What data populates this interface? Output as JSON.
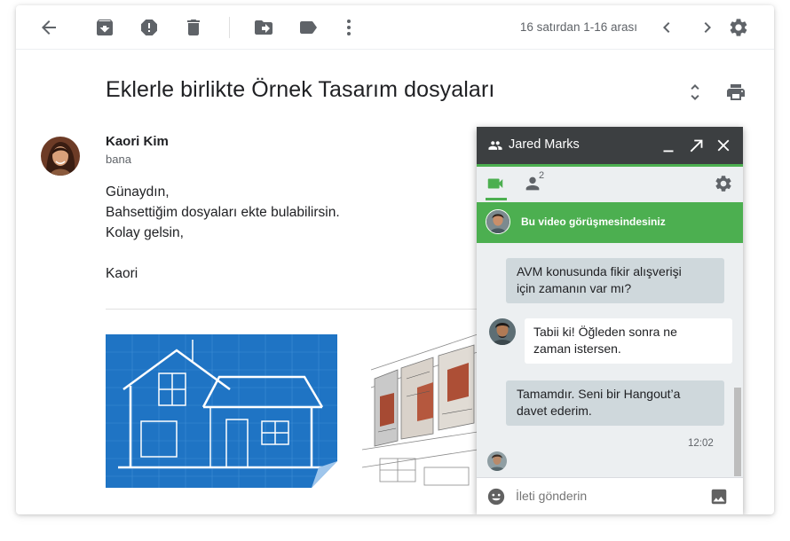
{
  "toolbar": {
    "buttons": [
      {
        "name": "back-button",
        "icon": "arrow-back-icon"
      },
      {
        "name": "archive-button",
        "icon": "archive-icon"
      },
      {
        "name": "report-spam-button",
        "icon": "report-icon"
      },
      {
        "name": "delete-button",
        "icon": "trash-icon"
      },
      {
        "name": "move-to-button",
        "icon": "move-to-icon"
      },
      {
        "name": "labels-button",
        "icon": "label-icon"
      },
      {
        "name": "more-button",
        "icon": "more-vert-icon"
      }
    ],
    "pagination_text": "16 satırdan 1-16 arası",
    "prev_icon": "chevron-left-icon",
    "next_icon": "chevron-right-icon",
    "settings_icon": "gear-icon"
  },
  "email": {
    "subject": "Eklerle birlikte Örnek Tasarım dosyaları",
    "expand_icon": "unfold-icon",
    "print_icon": "print-icon",
    "sender": {
      "name": "Kaori Kim",
      "to": "bana",
      "avatar": "avatar-photo"
    },
    "body": [
      "Günaydın,",
      "Bahsettiğim dosyaları ekte bulabilirsin.",
      "Kolay gelsin,",
      "Kaori"
    ],
    "attachments": [
      {
        "name": "blueprint-house-image"
      },
      {
        "name": "architecture-sketch-image"
      }
    ]
  },
  "hangout": {
    "title": "Jared Marks",
    "header_icons": [
      "people-icon",
      "minimize-icon",
      "popout-icon",
      "close-icon"
    ],
    "tabs": {
      "video_icon": "videocam-icon",
      "participants_icon": "person-icon",
      "participants_count": "2",
      "settings_icon": "gear-icon"
    },
    "banner_text": "Bu video görüşmesindesiniz",
    "messages": [
      {
        "from": "me",
        "lines": [
          "AVM konusunda fikir alışverişi",
          "için zamanın var mı?"
        ]
      },
      {
        "from": "them",
        "lines": [
          "Tabii ki! Öğleden sonra ne",
          "zaman istersen."
        ]
      },
      {
        "from": "me",
        "lines": [
          "Tamamdır. Seni bir Hangout’a",
          "davet ederim."
        ]
      }
    ],
    "time": "12:02",
    "input_placeholder": "İleti gönderin",
    "emoji_icon": "emoji-icon",
    "image_icon": "image-icon"
  },
  "colors": {
    "accent_green": "#4caf50",
    "hangout_header": "#3c3f41",
    "icon_gray": "#5f6368",
    "blueprint_blue": "#1a73c8"
  }
}
